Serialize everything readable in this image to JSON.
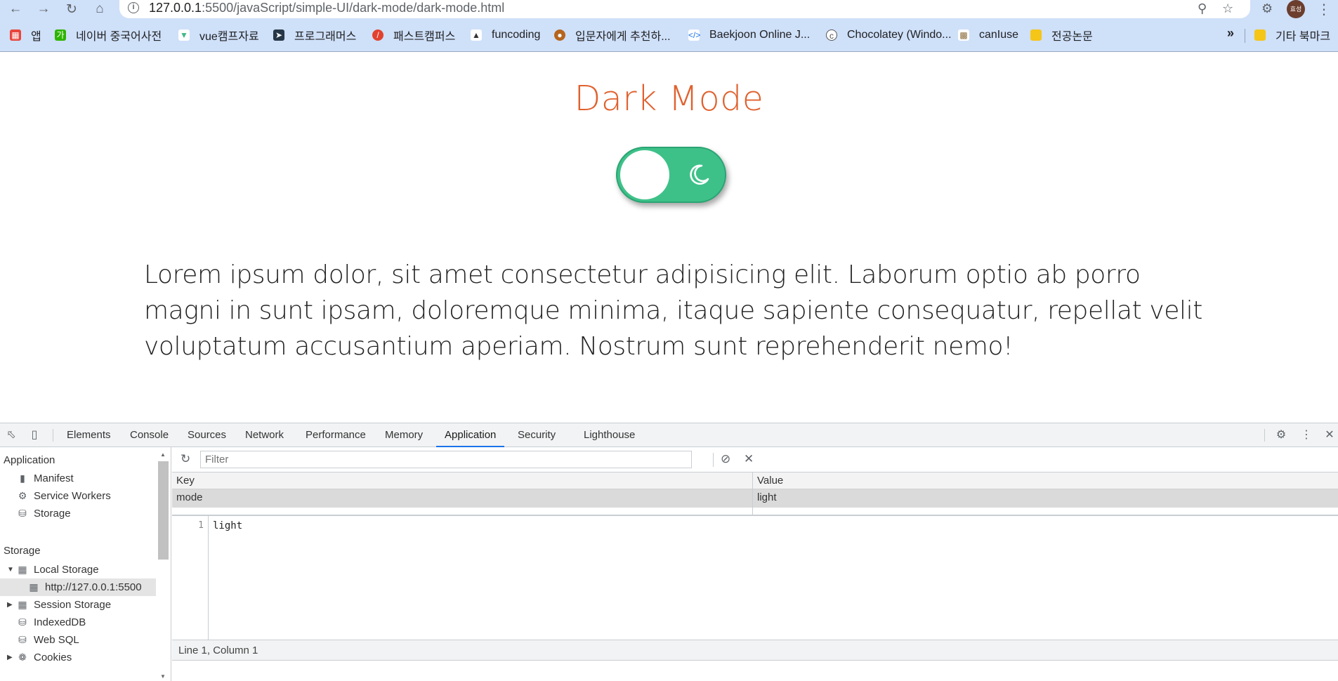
{
  "browser": {
    "url_prefix": "127.0.0.1",
    "url_rest": ":5500/javaScript/simple-UI/dark-mode/dark-mode.html",
    "back_icon": "back-arrow-icon",
    "forward_icon": "forward-arrow-icon",
    "reload_icon": "reload-icon",
    "home_icon": "home-icon",
    "avatar_text": "효성"
  },
  "bookmarks": {
    "items": [
      {
        "label": "앱",
        "icon": "apps-icon",
        "color": "#e8453c"
      },
      {
        "label": "네이버 중국어사전",
        "icon": "naver-icon",
        "color": "#2db400"
      },
      {
        "label": "vue캠프자료",
        "icon": "vue-icon",
        "color": "#41b883"
      },
      {
        "label": "프로그래머스",
        "icon": "programmers-icon",
        "color": "#263747"
      },
      {
        "label": "패스트캠퍼스",
        "icon": "fastcampus-icon",
        "color": "#e2412e"
      },
      {
        "label": "funcoding",
        "icon": "graduation-cap-icon",
        "color": "#333333"
      },
      {
        "label": "입문자에게 추천하...",
        "icon": "profile-icon",
        "color": "#b5651d"
      },
      {
        "label": "Baekjoon Online J...",
        "icon": "code-icon",
        "color": "#1a73e8"
      },
      {
        "label": "Chocolatey (Windo...",
        "icon": "chocolatey-icon",
        "color": "#555555"
      },
      {
        "label": "canIuse",
        "icon": "caniuse-icon",
        "color": "#8a6d3b"
      },
      {
        "label": "전공논문",
        "icon": "folder-icon",
        "color": "#f5c518"
      }
    ],
    "more": "»",
    "other": "기타 북마크"
  },
  "page": {
    "title": "Dark Mode",
    "toggle_state": "light",
    "paragraph": "Lorem ipsum dolor, sit amet consectetur adipisicing elit. Laborum optio ab porro magni in sunt ipsam, doloremque minima, itaque sapiente consequatur, repellat velit voluptatum accusantium aperiam. Nostrum sunt reprehenderit nemo!",
    "colors": {
      "title": "#e0612e",
      "toggle": "#3ec189"
    }
  },
  "devtools": {
    "tabs": [
      "Elements",
      "Console",
      "Sources",
      "Network",
      "Performance",
      "Memory",
      "Application",
      "Security",
      "Lighthouse"
    ],
    "active_tab": "Application",
    "sidebar": {
      "section_application": "Application",
      "app_items": [
        "Manifest",
        "Service Workers",
        "Storage"
      ],
      "section_storage": "Storage",
      "local_storage": "Local Storage",
      "local_origin": "http://127.0.0.1:5500",
      "session_storage": "Session Storage",
      "indexeddb": "IndexedDB",
      "websql": "Web SQL",
      "cookies": "Cookies"
    },
    "filter_placeholder": "Filter",
    "grid": {
      "headers": [
        "Key",
        "Value"
      ],
      "rows": [
        {
          "key": "mode",
          "value": "light"
        }
      ]
    },
    "preview": {
      "line_number": "1",
      "content": "light"
    },
    "status": "Line 1, Column 1"
  }
}
